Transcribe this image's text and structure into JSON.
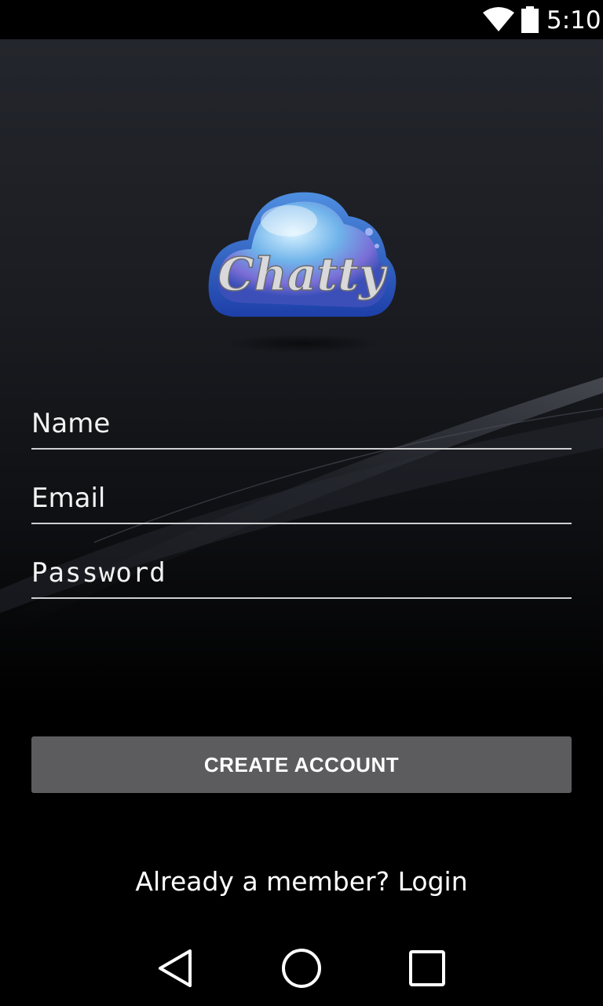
{
  "status_bar": {
    "time": "5:10",
    "icons": [
      "wifi-icon",
      "battery-icon"
    ]
  },
  "logo": {
    "text": "Chatty",
    "colors": [
      "#5aa8e8",
      "#8a6fd8",
      "#1e4fb0"
    ]
  },
  "form": {
    "name_placeholder": "Name",
    "email_placeholder": "Email",
    "password_placeholder": "Password",
    "name_value": "",
    "email_value": "",
    "password_value": ""
  },
  "actions": {
    "create_account_label": "CREATE ACCOUNT",
    "login_prompt": "Already a member? Login"
  },
  "nav_bar": {
    "icons": [
      "back-icon",
      "home-icon",
      "recents-icon"
    ]
  },
  "colors": {
    "button_bg": "#5c5c5e",
    "underline": "#cfcfd2",
    "text": "#ffffff"
  }
}
